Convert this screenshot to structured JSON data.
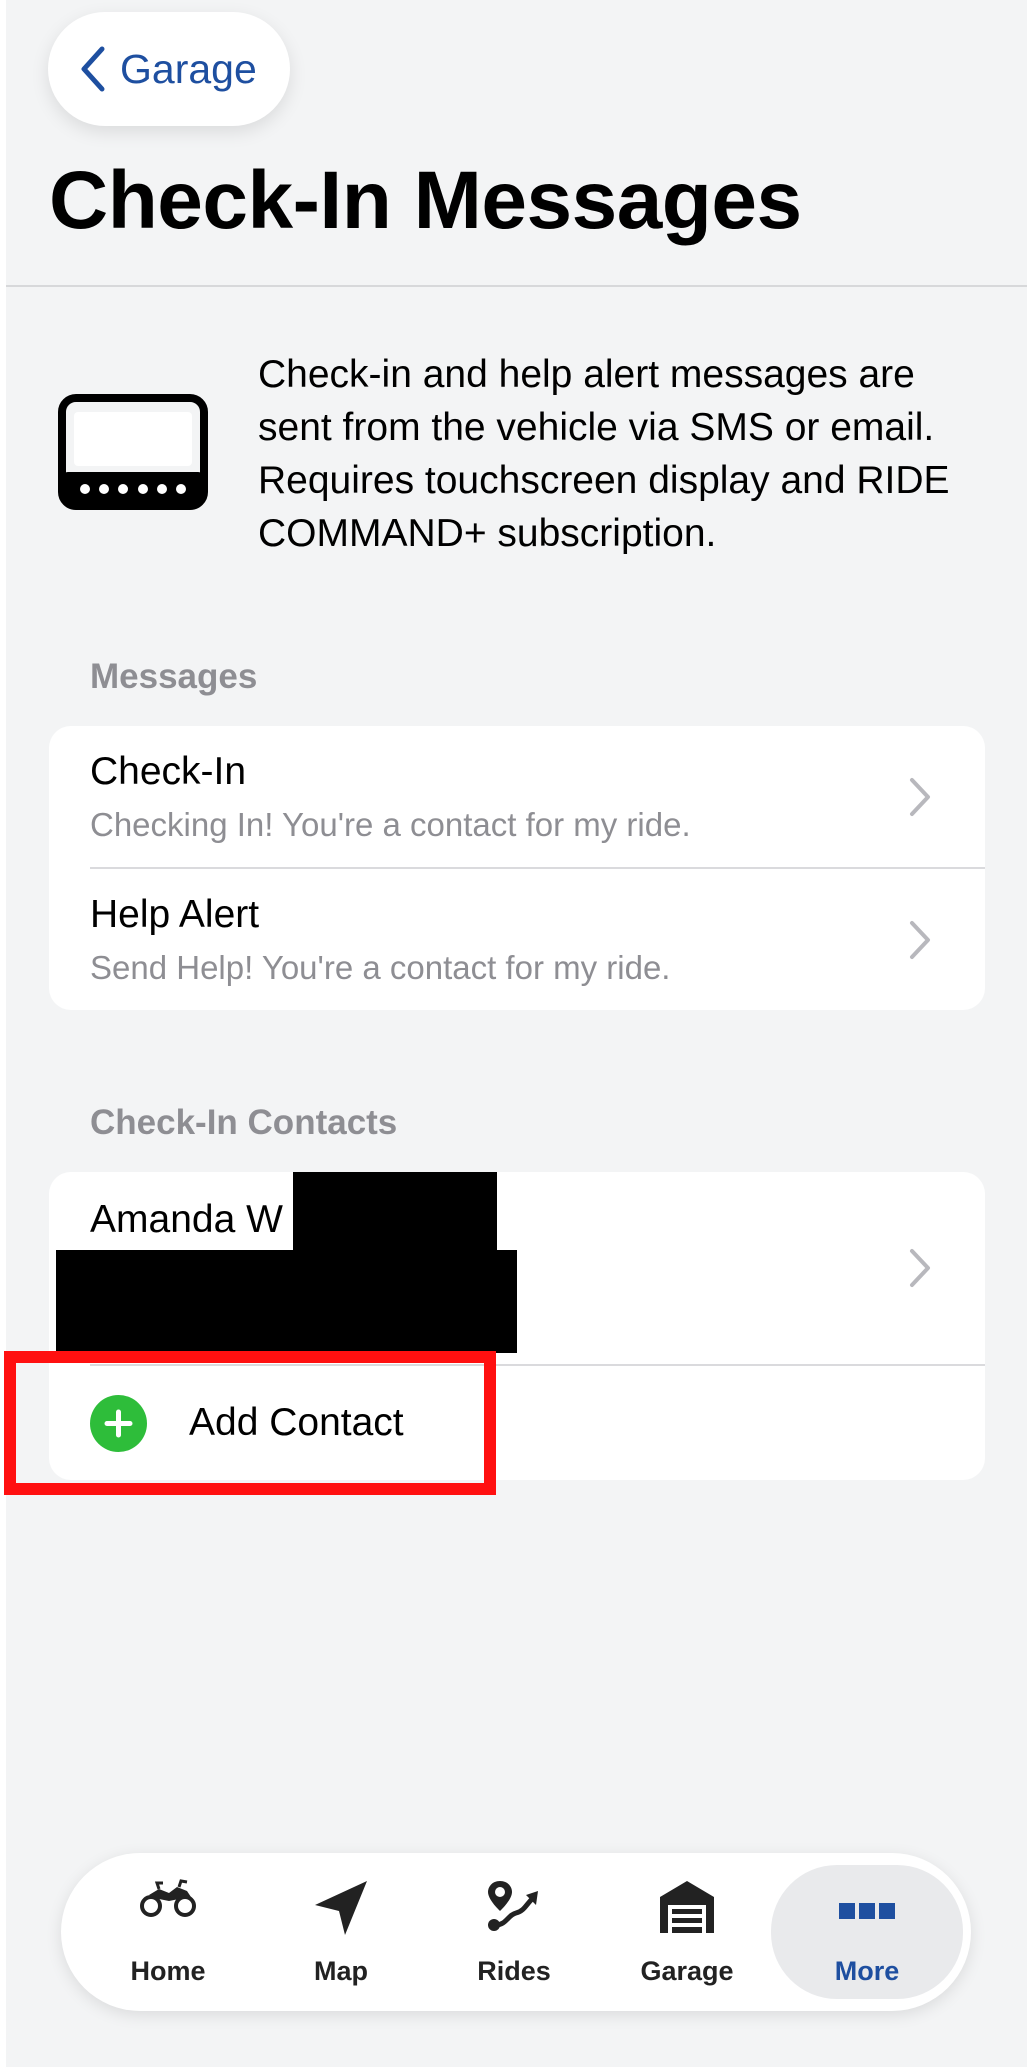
{
  "nav": {
    "back_label": "Garage"
  },
  "page": {
    "title": "Check-In Messages"
  },
  "intro": {
    "icon": "touchscreen-display-icon",
    "text": "Check-in and help alert messages are sent from the vehicle via SMS or email. Requires touchscreen display and RIDE COMMAND+ subscription."
  },
  "messages": {
    "header": "Messages",
    "items": [
      {
        "title": "Check-In",
        "subtitle": "Checking In! You're a contact for my ride."
      },
      {
        "title": "Help Alert",
        "subtitle": "Send Help! You're a contact for my ride."
      }
    ]
  },
  "contacts": {
    "header": "Check-In Contacts",
    "items": [
      {
        "name": "Amanda W"
      }
    ],
    "add_label": "Add Contact"
  },
  "tabbar": {
    "tabs": [
      {
        "label": "Home",
        "icon": "atv-icon"
      },
      {
        "label": "Map",
        "icon": "navigation-arrow-icon"
      },
      {
        "label": "Rides",
        "icon": "route-icon"
      },
      {
        "label": "Garage",
        "icon": "garage-icon"
      },
      {
        "label": "More",
        "icon": "more-icon",
        "active": true
      }
    ]
  },
  "colors": {
    "accent": "#1e4fa0",
    "add_green": "#2ebd3a",
    "highlight_red": "#ff1010",
    "background": "#f3f4f5"
  }
}
